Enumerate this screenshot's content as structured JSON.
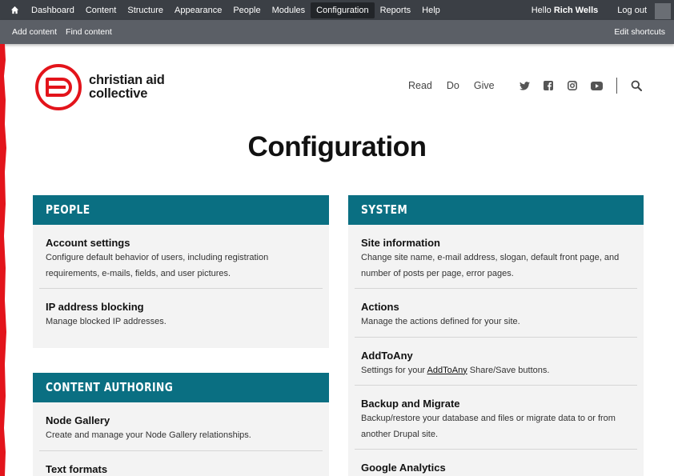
{
  "toolbar": {
    "home_icon": "home-icon",
    "menu": [
      "Dashboard",
      "Content",
      "Structure",
      "Appearance",
      "People",
      "Modules",
      "Configuration",
      "Reports",
      "Help"
    ],
    "active": "Configuration",
    "greeting_prefix": "Hello ",
    "user": "Rich Wells",
    "logout": "Log out"
  },
  "shortcuts": {
    "add_content": "Add content",
    "find_content": "Find content",
    "edit": "Edit shortcuts"
  },
  "site": {
    "logo_line1": "christian aid",
    "logo_line2": "collective",
    "nav": [
      "Read",
      "Do",
      "Give"
    ],
    "social": [
      "twitter-icon",
      "facebook-icon",
      "instagram-icon",
      "youtube-icon"
    ],
    "brand_red": "#e3141b",
    "accent_teal": "#0a6f82"
  },
  "page": {
    "title": "Configuration"
  },
  "panels": {
    "people": {
      "title": "PEOPLE",
      "items": [
        {
          "title": "Account settings",
          "desc": "Configure default behavior of users, including registration requirements, e-mails, fields, and user pictures."
        },
        {
          "title": "IP address blocking",
          "desc": "Manage blocked IP addresses."
        }
      ]
    },
    "content": {
      "title": "CONTENT AUTHORING",
      "items": [
        {
          "title": "Node Gallery",
          "desc": "Create and manage your Node Gallery relationships."
        },
        {
          "title": "Text formats",
          "desc": ""
        }
      ]
    },
    "system": {
      "title": "SYSTEM",
      "items": [
        {
          "title": "Site information",
          "desc": "Change site name, e-mail address, slogan, default front page, and number of posts per page, error pages."
        },
        {
          "title": "Actions",
          "desc": "Manage the actions defined for your site."
        },
        {
          "title": "AddToAny",
          "desc_prefix": "Settings for your ",
          "desc_link": "AddToAny",
          "desc_suffix": " Share/Save buttons."
        },
        {
          "title": "Backup and Migrate",
          "desc": "Backup/restore your database and files or migrate data to or from another Drupal site."
        },
        {
          "title": "Google Analytics",
          "desc": ""
        }
      ]
    }
  }
}
